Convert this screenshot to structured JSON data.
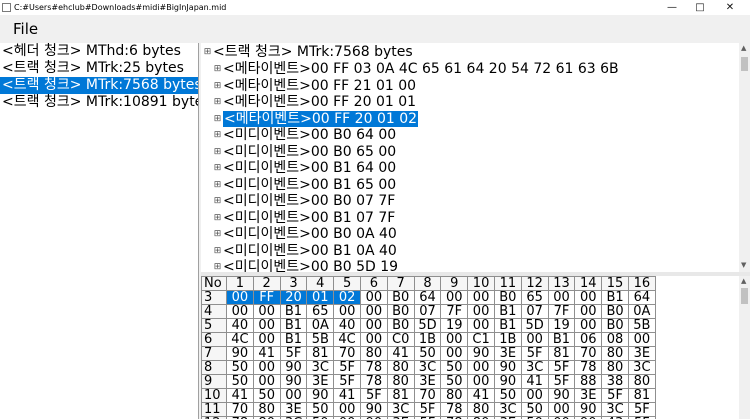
{
  "window": {
    "title": "C:#Users#ehclub#Downloads#midi#BigInJapan.mid",
    "minimize": "—",
    "maximize": "□",
    "close": "✕"
  },
  "menu": {
    "file": "File"
  },
  "chunks": [
    {
      "label": "<헤더 청크> MThd:6 bytes",
      "selected": false
    },
    {
      "label": "<트랙 청크> MTrk:25 bytes",
      "selected": false
    },
    {
      "label": "<트랙 청크> MTrk:7568 bytes",
      "selected": true
    },
    {
      "label": "<트랙 청크> MTrk:10891 bytes",
      "selected": false
    }
  ],
  "tree": {
    "root": "<트랙 청크> MTrk:7568 bytes",
    "items": [
      {
        "label": "<메타이벤트>00 FF 03 0A 4C 65 61 64 20 54 72 61 63 6B",
        "selected": false
      },
      {
        "label": "<메타이벤트>00 FF 21 01 00",
        "selected": false
      },
      {
        "label": "<메타이벤트>00 FF 20 01 01",
        "selected": false
      },
      {
        "label": "<메타이벤트>00 FF 20 01 02",
        "selected": true
      },
      {
        "label": "<미디이벤트>00 B0 64 00",
        "selected": false
      },
      {
        "label": "<미디이벤트>00 B0 65 00",
        "selected": false
      },
      {
        "label": "<미디이벤트>00 B1 64 00",
        "selected": false
      },
      {
        "label": "<미디이벤트>00 B1 65 00",
        "selected": false
      },
      {
        "label": "<미디이벤트>00 B0 07 7F",
        "selected": false
      },
      {
        "label": "<미디이벤트>00 B1 07 7F",
        "selected": false
      },
      {
        "label": "<미디이벤트>00 B0 0A 40",
        "selected": false
      },
      {
        "label": "<미디이벤트>00 B1 0A 40",
        "selected": false
      },
      {
        "label": "<미디이벤트>00 B0 5D 19",
        "selected": false
      }
    ]
  },
  "hex": {
    "headers": [
      "No",
      "1",
      "2",
      "3",
      "4",
      "5",
      "6",
      "7",
      "8",
      "9",
      "10",
      "11",
      "12",
      "13",
      "14",
      "15",
      "16"
    ],
    "rows": [
      [
        "3",
        "00",
        "FF",
        "20",
        "01",
        "02",
        "00",
        "B0",
        "64",
        "00",
        "00",
        "B0",
        "65",
        "00",
        "00",
        "B1",
        "64"
      ],
      [
        "4",
        "00",
        "00",
        "B1",
        "65",
        "00",
        "00",
        "B0",
        "07",
        "7F",
        "00",
        "B1",
        "07",
        "7F",
        "00",
        "B0",
        "0A"
      ],
      [
        "5",
        "40",
        "00",
        "B1",
        "0A",
        "40",
        "00",
        "B0",
        "5D",
        "19",
        "00",
        "B1",
        "5D",
        "19",
        "00",
        "B0",
        "5B"
      ],
      [
        "6",
        "4C",
        "00",
        "B1",
        "5B",
        "4C",
        "00",
        "C0",
        "1B",
        "00",
        "C1",
        "1B",
        "00",
        "B1",
        "06",
        "08",
        "00"
      ],
      [
        "7",
        "90",
        "41",
        "5F",
        "81",
        "70",
        "80",
        "41",
        "50",
        "00",
        "90",
        "3E",
        "5F",
        "81",
        "70",
        "80",
        "3E"
      ],
      [
        "8",
        "50",
        "00",
        "90",
        "3C",
        "5F",
        "78",
        "80",
        "3C",
        "50",
        "00",
        "90",
        "3C",
        "5F",
        "78",
        "80",
        "3C"
      ],
      [
        "9",
        "50",
        "00",
        "90",
        "3E",
        "5F",
        "78",
        "80",
        "3E",
        "50",
        "00",
        "90",
        "41",
        "5F",
        "88",
        "38",
        "80"
      ],
      [
        "10",
        "41",
        "50",
        "00",
        "90",
        "41",
        "5F",
        "81",
        "70",
        "80",
        "41",
        "50",
        "00",
        "90",
        "3E",
        "5F",
        "81"
      ],
      [
        "11",
        "70",
        "80",
        "3E",
        "50",
        "00",
        "90",
        "3C",
        "5F",
        "78",
        "80",
        "3C",
        "50",
        "00",
        "90",
        "3C",
        "5F"
      ],
      [
        "12",
        "78",
        "80",
        "3C",
        "50",
        "00",
        "90",
        "3E",
        "5F",
        "78",
        "80",
        "3E",
        "50",
        "00",
        "90",
        "43",
        "5F"
      ]
    ],
    "selected": [
      [
        0,
        1
      ],
      [
        0,
        2
      ],
      [
        0,
        3
      ],
      [
        0,
        4
      ],
      [
        0,
        5
      ]
    ]
  }
}
